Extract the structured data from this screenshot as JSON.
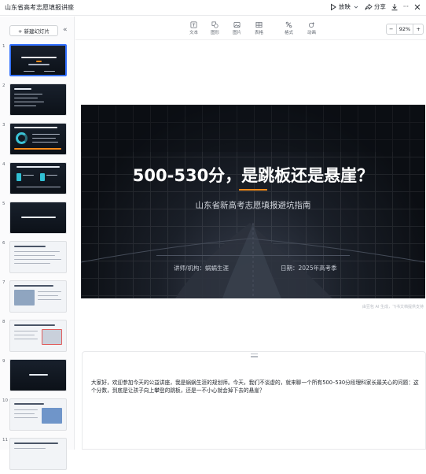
{
  "window": {
    "title": "山东省高考志愿填报讲座"
  },
  "topbar": {
    "present_label": "放映",
    "share_label": "分享",
    "more_label": "···"
  },
  "sidebar": {
    "new_slide_label": "+ 新建幻灯片",
    "thumbnails": [
      {
        "number": "1",
        "title": "500-530分，是跳板还是悬崖？"
      },
      {
        "number": "2",
        "title": ""
      },
      {
        "number": "3",
        "title": "2024年山东省500-530分段考生分布"
      },
      {
        "number": "4",
        "title": "误区一"
      },
      {
        "number": "5",
        "title": "为什么500-530分尤为关键？"
      },
      {
        "number": "6",
        "title": ""
      },
      {
        "number": "7",
        "title": ""
      },
      {
        "number": "8",
        "title": ""
      },
      {
        "number": "9",
        "title": "如何破局？"
      },
      {
        "number": "10",
        "title": ""
      },
      {
        "number": "11",
        "title": ""
      }
    ]
  },
  "toolbar": {
    "tools": [
      {
        "icon": "text-icon",
        "label": "文本"
      },
      {
        "icon": "shape-icon",
        "label": "图形"
      },
      {
        "icon": "image-icon",
        "label": "图片"
      },
      {
        "icon": "table-icon",
        "label": "表格"
      },
      {
        "icon": "format-icon",
        "label": "格式"
      },
      {
        "icon": "animation-icon",
        "label": "动画"
      }
    ],
    "zoom": {
      "minus": "−",
      "value": "92%",
      "plus": "+"
    }
  },
  "slide": {
    "title": "500-530分，是跳板还是悬崖？",
    "subtitle": "山东省新高考志愿填报避坑指南",
    "presenter": "讲师/机构：蜗蜗生涯",
    "date": "日期：2025年高考季",
    "ai_note": "由豆包 AI 生成，飞书文档提供支持"
  },
  "notes": {
    "text": "大家好，欢迎参加今天的公益讲座，我是蜗蜗生涯的规划师。今天，我们不谈虚的，就来聊一个所有500–530分段理科家长最关心的问题：这个分数，到底是让孩子向上攀登的跳板，还是一不小心就会掉下去的悬崖？"
  },
  "colors": {
    "accent_blue": "#3370ff",
    "slide_accent_orange": "#f08a1c"
  }
}
